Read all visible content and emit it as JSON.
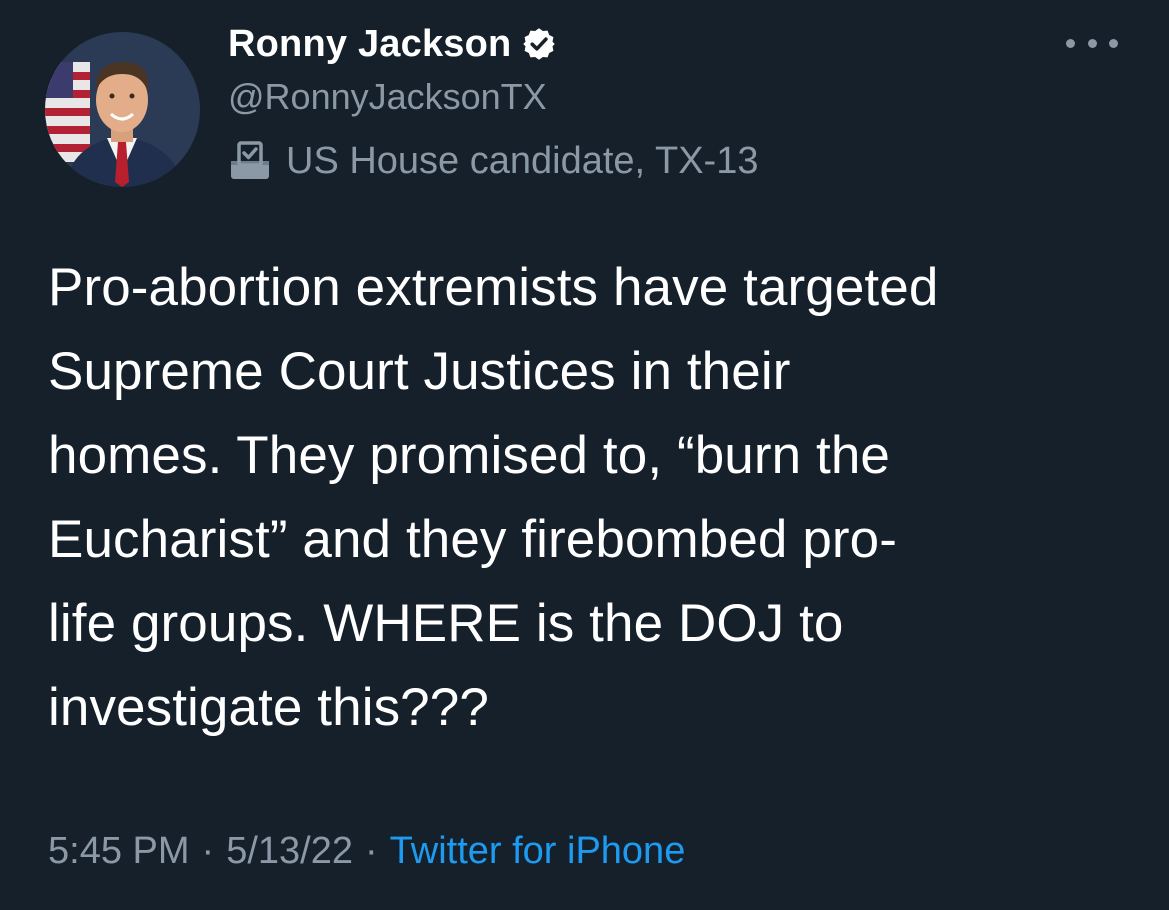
{
  "author": {
    "display_name": "Ronny Jackson",
    "handle": "@RonnyJacksonTX",
    "label": "US House candidate, TX-13",
    "verified_icon": "verified-badge-icon",
    "label_icon": "ballot-box-icon"
  },
  "tweet": {
    "text": "Pro-abortion extremists have targeted\nSupreme Court Justices in their\nhomes. They promised to, “burn the\nEucharist” and they firebombed pro-\nlife groups. WHERE is the DOJ to\ninvestigate this???"
  },
  "meta": {
    "time": "5:45 PM",
    "separator": "·",
    "date": "5/13/22",
    "source": "Twitter for iPhone"
  },
  "colors": {
    "background": "#15202b",
    "primary_text": "#ffffff",
    "secondary_text": "#8b98a5",
    "link": "#1d9bf0"
  }
}
